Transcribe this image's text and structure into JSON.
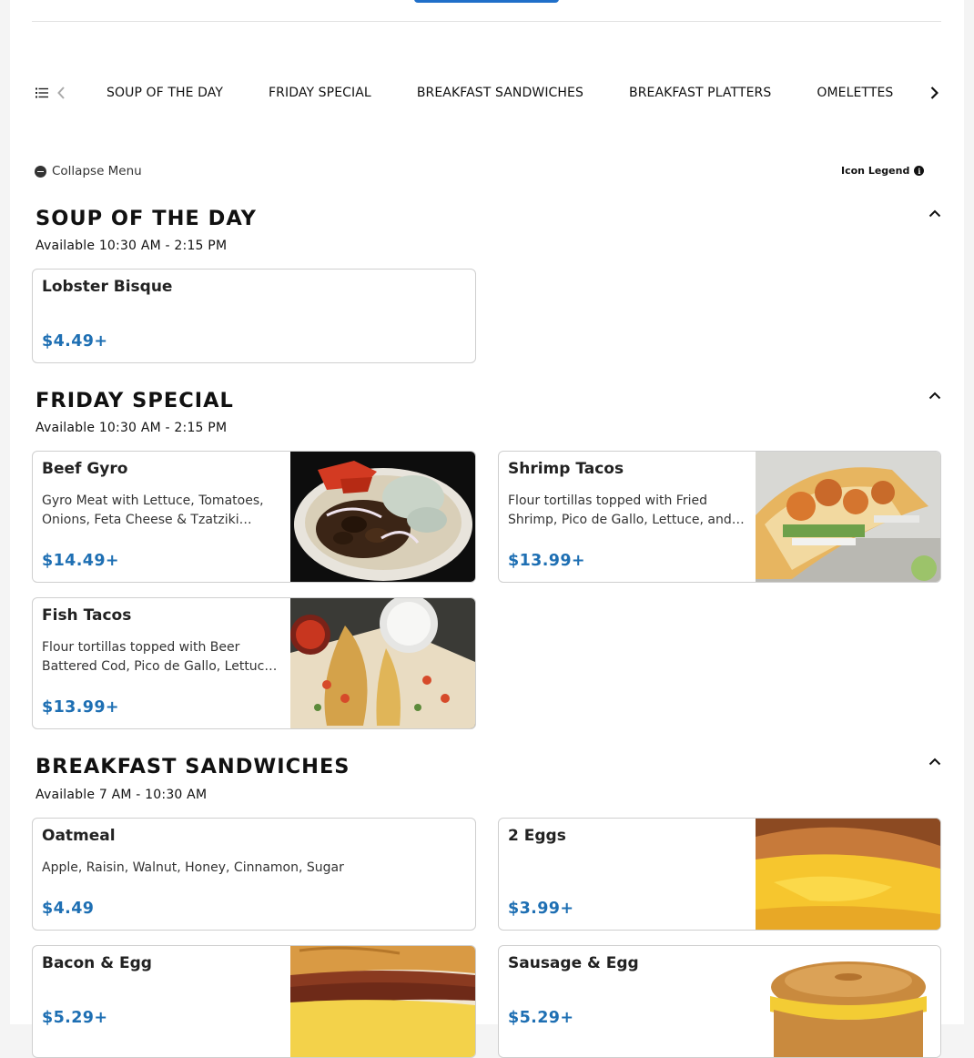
{
  "nav": {
    "items": [
      "SOUP OF THE DAY",
      "FRIDAY SPECIAL",
      "BREAKFAST SANDWICHES",
      "BREAKFAST PLATTERS",
      "OMELETTES"
    ]
  },
  "controls": {
    "collapse_label": "Collapse Menu",
    "legend_label": "Icon Legend",
    "legend_icon": "i"
  },
  "sections": [
    {
      "title": "SOUP OF THE DAY",
      "availability": "Available 10:30 AM - 2:15 PM",
      "items": [
        {
          "name": "Lobster Bisque",
          "description": "",
          "price": "$4.49+",
          "image": "none"
        }
      ]
    },
    {
      "title": "FRIDAY SPECIAL",
      "availability": "Available 10:30 AM - 2:15 PM",
      "items": [
        {
          "name": "Beef Gyro",
          "description": "Gyro Meat with Lettuce, Tomatoes, Onions, Feta Cheese & Tzatziki sauce",
          "price": "$14.49+",
          "image": "beef-gyro-photo"
        },
        {
          "name": "Shrimp Tacos",
          "description": "Flour tortillas topped with Fried Shrimp, Pico de Gallo, Lettuce, and Cheese",
          "price": "$13.99+",
          "image": "shrimp-tacos-photo"
        },
        {
          "name": "Fish Tacos",
          "description": "Flour tortillas topped with Beer Battered Cod, Pico de Gallo, Lettuce and Cheese",
          "price": "$13.99+",
          "image": "fish-tacos-photo"
        }
      ]
    },
    {
      "title": "BREAKFAST SANDWICHES",
      "availability": "Available 7 AM - 10:30 AM",
      "items": [
        {
          "name": "Oatmeal",
          "description": "Apple, Raisin, Walnut, Honey, Cinnamon, Sugar",
          "price": "$4.49",
          "image": "none"
        },
        {
          "name": "2 Eggs",
          "description": "",
          "price": "$3.99+",
          "image": "egg-sandwich-photo"
        },
        {
          "name": "Bacon & Egg",
          "description": "",
          "price": "$5.29+",
          "image": "bacon-egg-croissant-photo"
        },
        {
          "name": "Sausage & Egg",
          "description": "",
          "price": "$5.29+",
          "image": "sausage-egg-bagel-photo"
        }
      ]
    }
  ],
  "colors": {
    "price": "#1e6fb3",
    "accent": "#1f6fc9",
    "border": "#cfcfcf"
  }
}
